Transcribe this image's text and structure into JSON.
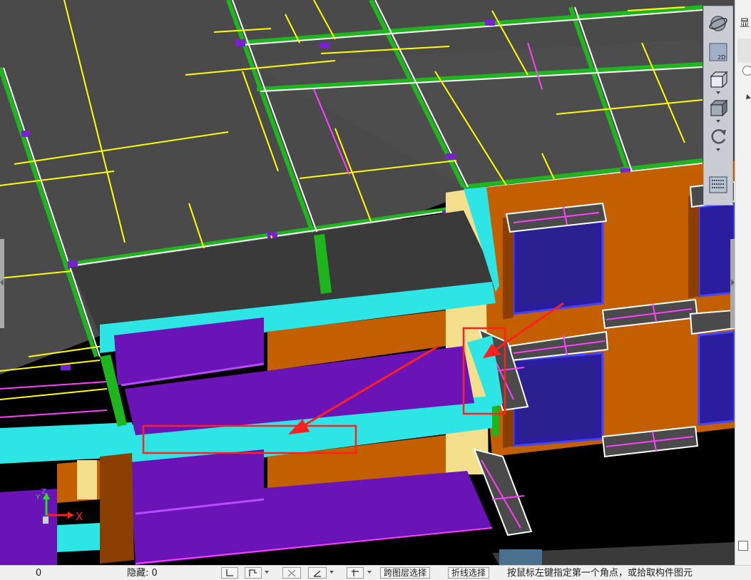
{
  "viewport": {
    "axis_labels": {
      "x": "X",
      "y": "Y",
      "z": "Z"
    },
    "highlight_color": "#ff2020",
    "colors": {
      "slab": "#4a4a4a",
      "beam_green": "#1fb51f",
      "rebar_yellow": "#ffff00",
      "rebar_pink": "#ff40ff",
      "wall_orange": "#c45f00",
      "ledge_cyan": "#2ee5e5",
      "balcony_purple": "#6a14b8",
      "window_blue": "#2a1e9e",
      "column_cream": "#f4e08c",
      "edge_white": "#ffffff"
    }
  },
  "nav_toolbar": {
    "buttons": [
      {
        "name": "dynamic-observe-icon",
        "label": ""
      },
      {
        "name": "view-2d-icon",
        "label": "2D"
      },
      {
        "name": "view-3d-box-icon",
        "label": ""
      },
      {
        "name": "view-solid-box-icon",
        "label": ""
      },
      {
        "name": "rotate-icon",
        "label": ""
      },
      {
        "name": "display-settings-icon",
        "label": ""
      }
    ]
  },
  "right_panel": {
    "title_fragment": "显"
  },
  "status_bar": {
    "count_value": "0",
    "hidden_label": "隐藏: 0",
    "cross_layer_select": "跨图层选择",
    "polyline_select": "折线选择",
    "hint": "按鼠标左键指定第一个角点，或拾取构件图元"
  }
}
